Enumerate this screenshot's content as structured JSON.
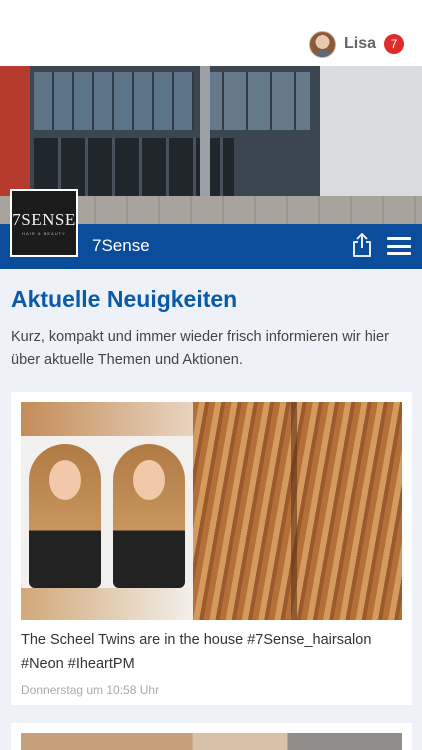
{
  "header": {
    "user_name": "Lisa",
    "notification_count": "7"
  },
  "brand": {
    "logo_text": "7SENSE",
    "logo_subtext": "HAIR & BEAUTY",
    "name": "7Sense",
    "accent_color": "#0b4d9a"
  },
  "news": {
    "title": "Aktuelle Neuigkeiten",
    "intro": "Kurz, kompakt und immer wieder frisch informieren wir hier über aktuelle Themen und Aktionen.",
    "posts": [
      {
        "caption": "The Scheel Twins are in the house #7Sense_hairsalon #Neon #IheartPM",
        "time": "Donnerstag um 10:58 Uhr"
      }
    ]
  }
}
